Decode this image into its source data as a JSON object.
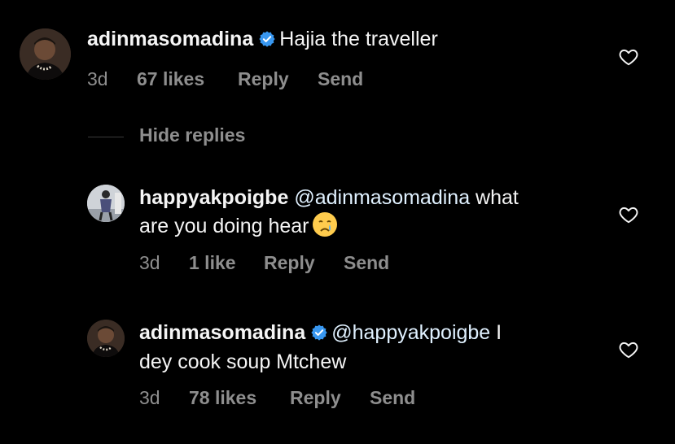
{
  "comments": [
    {
      "username": "adinmasomadina",
      "verified": true,
      "mention": "",
      "text": "Hajia the traveller",
      "time": "3d",
      "likes": "67 likes",
      "reply": "Reply",
      "send": "Send"
    },
    {
      "username": "happyakpoigbe",
      "verified": false,
      "mention": "@adinmasomadina",
      "text_line1": " what",
      "text_line2": "are you doing hear",
      "emoji": "crying-face",
      "time": "3d",
      "likes": "1 like",
      "reply": "Reply",
      "send": "Send"
    },
    {
      "username": "adinmasomadina",
      "verified": true,
      "mention": "@happyakpoigbe",
      "text_line1": " I",
      "text_line2": "dey cook soup Mtchew",
      "time": "3d",
      "likes": "78 likes",
      "reply": "Reply",
      "send": "Send"
    }
  ],
  "thread": {
    "hide_replies": "Hide replies"
  },
  "colors": {
    "background": "#000000",
    "text": "#f5f5f5",
    "muted": "#8e8e8e",
    "verified": "#3897f0",
    "mention": "#e0f1ff"
  },
  "icons": [
    "heart-outline-icon",
    "verified-badge-icon",
    "crying-face-emoji"
  ]
}
